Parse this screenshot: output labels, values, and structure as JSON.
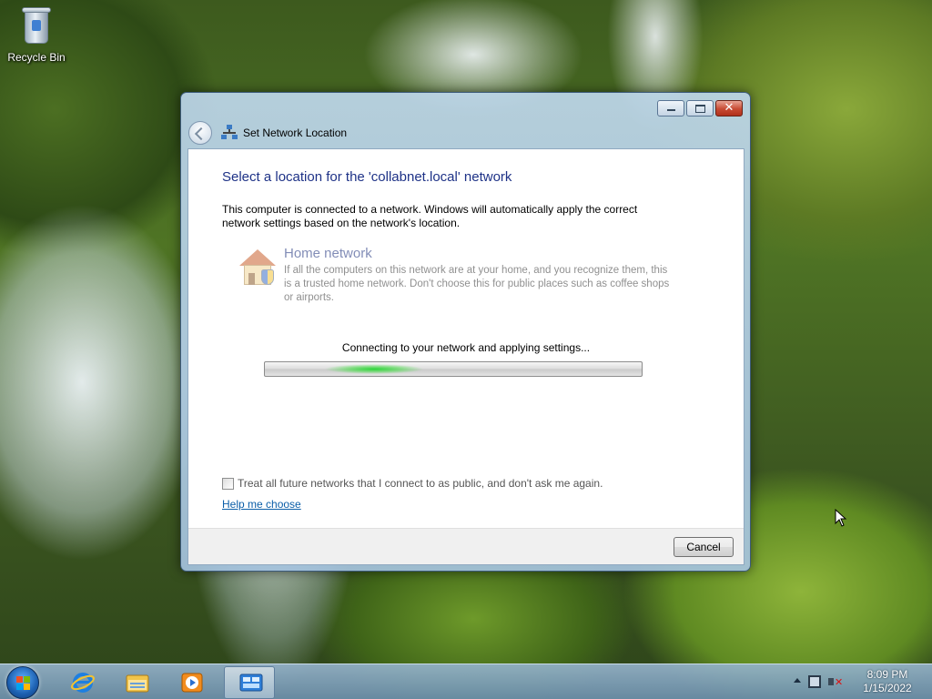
{
  "desktop": {
    "icons": [
      {
        "label": "Recycle Bin",
        "icon": "recycle-bin-icon"
      }
    ]
  },
  "window": {
    "title": "Set Network Location",
    "title_icon": "network-icon",
    "caption_buttons": {
      "minimize": "minimize",
      "maximize": "maximize",
      "close": "✕"
    },
    "heading": "Select a location for the 'collabnet.local' network",
    "description": "This computer is connected to a network. Windows will automatically apply the correct network settings based on the network's location.",
    "option": {
      "icon": "home-network-icon",
      "title": "Home network",
      "description": "If all the computers on this network are at your home, and you recognize them, this is a trusted home network.  Don't choose this for public places such as coffee shops or airports.",
      "enabled": false
    },
    "status": "Connecting to your network and applying settings...",
    "progress": {
      "mode": "marquee",
      "color": "#2ed53a"
    },
    "checkbox": {
      "label": "Treat all future networks that I connect to as public, and don't ask me again.",
      "checked": false,
      "enabled": false
    },
    "help_link": "Help me choose",
    "cancel_label": "Cancel"
  },
  "taskbar": {
    "start_icon": "windows-start-icon",
    "pinned": [
      {
        "name": "internet-explorer-icon",
        "active": false
      },
      {
        "name": "windows-explorer-icon",
        "active": false
      },
      {
        "name": "media-player-icon",
        "active": false
      },
      {
        "name": "network-settings-icon",
        "active": true
      }
    ],
    "tray": {
      "icons": [
        "show-hidden-icons-arrow",
        "network-icon",
        "volume-muted-icon"
      ],
      "time": "8:09 PM",
      "date": "1/15/2022"
    }
  },
  "colors": {
    "heading": "#1e3287",
    "link": "#0b5ea8",
    "taskbar": "#86a8c6"
  }
}
